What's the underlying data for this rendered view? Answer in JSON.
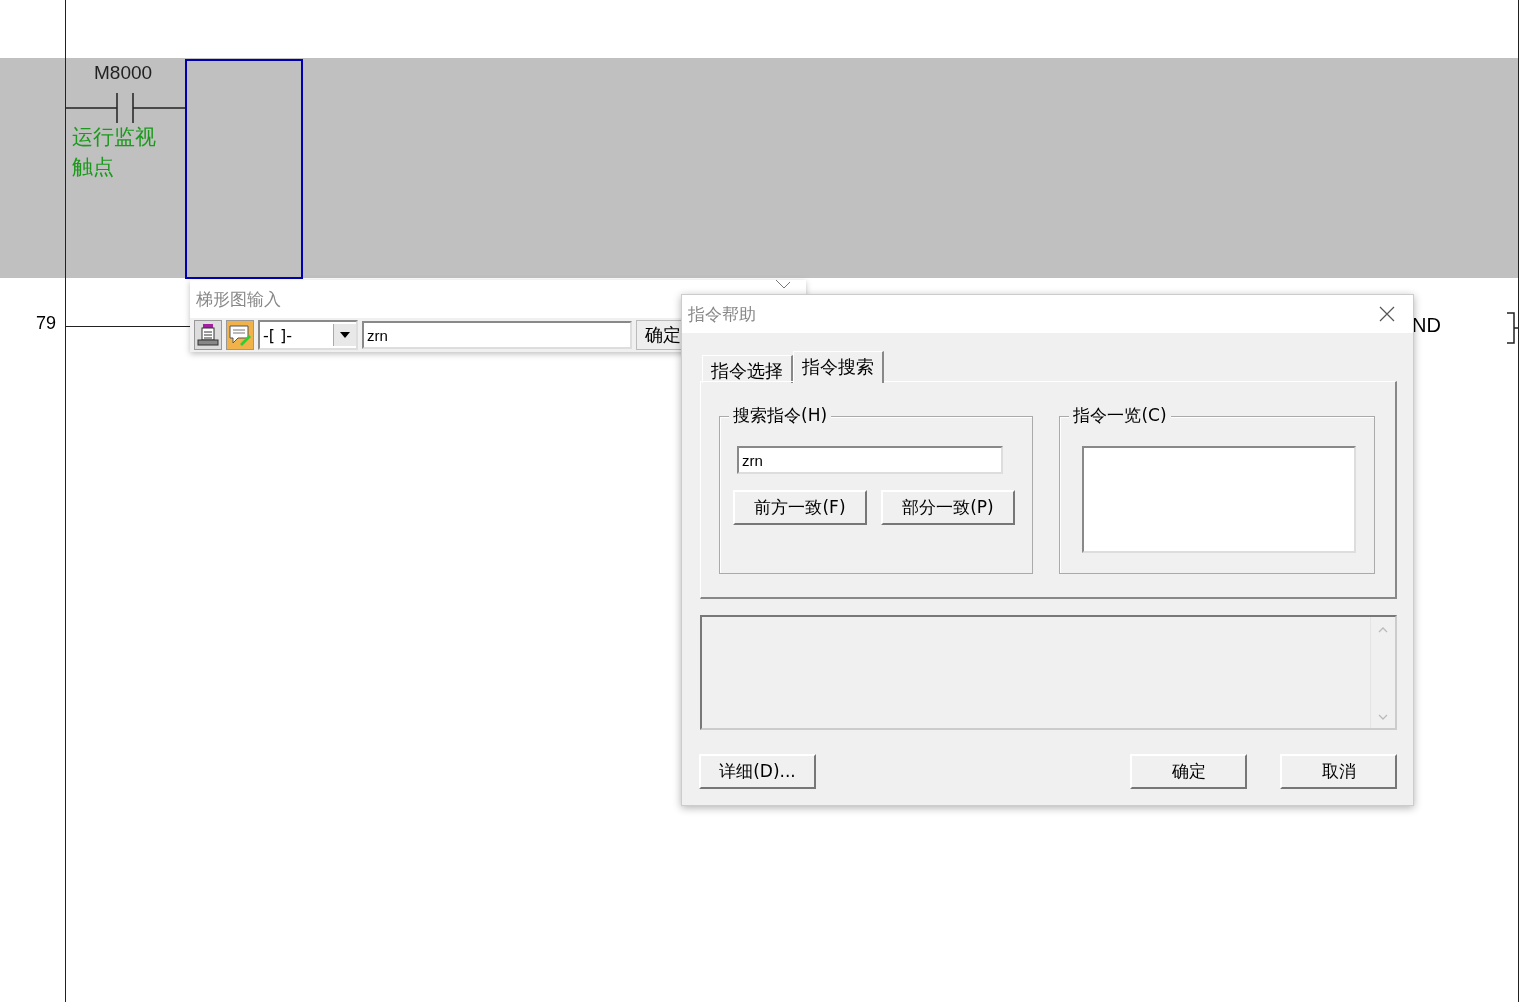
{
  "ladder": {
    "rungs": [
      {
        "kind": "contact",
        "device": "M8000",
        "comment": "运行监视触点",
        "selected": true
      },
      {
        "kind": "end",
        "step": "79",
        "instruction": "ND",
        "selected": false
      }
    ]
  },
  "ladder_input": {
    "title": "梯形图输入",
    "symbol": "-[ ]-",
    "value": "zrn",
    "ok_button": "确定"
  },
  "dialog": {
    "title": "指令帮助",
    "tabs": [
      {
        "label": "指令选择",
        "selected": false
      },
      {
        "label": "指令搜索",
        "selected": true
      }
    ],
    "search_group": {
      "label": "搜索指令(H)",
      "value": "zrn",
      "buttons": [
        "前方一致(F)",
        "部分一致(P)"
      ]
    },
    "list_group": {
      "label": "指令一览(C)"
    },
    "buttons": [
      "详细(D)...",
      "确定",
      "取消"
    ]
  }
}
